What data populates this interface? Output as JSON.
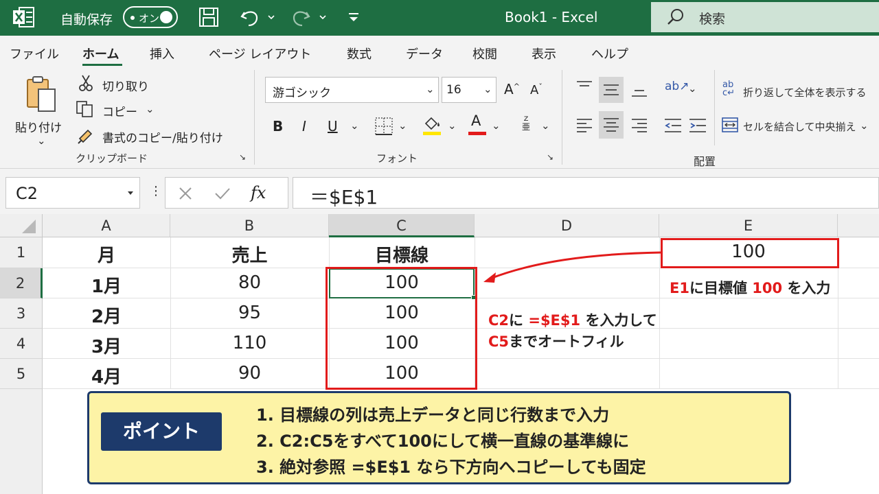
{
  "titlebar": {
    "autosave_label": "自動保存",
    "autosave_state": "オン",
    "doc_title": "Book1  -  Excel",
    "search_placeholder": "検索"
  },
  "tabs": [
    "ファイル",
    "ホーム",
    "挿入",
    "ページ レイアウト",
    "数式",
    "データ",
    "校閲",
    "表示",
    "ヘルプ"
  ],
  "active_tab": "ホーム",
  "ribbon": {
    "clipboard": {
      "paste": "貼り付け",
      "cut": "切り取り",
      "copy": "コピー",
      "format_painter": "書式のコピー/貼り付け",
      "group_label": "クリップボード"
    },
    "font": {
      "font_name": "游ゴシック",
      "font_size": "16",
      "bold": "B",
      "italic": "I",
      "underline": "U",
      "group_label": "フォント",
      "fill_color": "#ffe600",
      "font_color": "#e21b1b"
    },
    "alignment": {
      "wrap_text": "折り返して全体を表示する",
      "merge_center": "セルを結合して中央揃え",
      "group_label": "配置"
    }
  },
  "formula_bar": {
    "name_box": "C2",
    "formula": "＝$E$1"
  },
  "sheet": {
    "columns": [
      "A",
      "B",
      "C",
      "D",
      "E"
    ],
    "selected_column": "C",
    "rows": [
      "1",
      "2",
      "3",
      "4",
      "5"
    ],
    "selected_row": "2",
    "headers": {
      "A": "月",
      "B": "売上",
      "C": "目標線"
    },
    "data": [
      {
        "month": "1月",
        "sales": "80",
        "target": "100"
      },
      {
        "month": "2月",
        "sales": "95",
        "target": "100"
      },
      {
        "month": "3月",
        "sales": "110",
        "target": "100"
      },
      {
        "month": "4月",
        "sales": "90",
        "target": "100"
      }
    ],
    "e1": "100"
  },
  "annotations": {
    "e1_ref": "E1",
    "e1_mid": "に目標値",
    "e1_val": "100",
    "e1_tail": "を入力",
    "c2_ref": "C2",
    "c2_mid": "に",
    "c2_formula": "=$E$1",
    "c2_tail": "を入力して",
    "c5_ref": "C5",
    "c5_tail": "までオートフィル"
  },
  "point": {
    "badge": "ポイント",
    "lines": [
      "1.  目標線の列は売上データと同じ行数まで入力",
      "2.  C2:C5をすべて100にして横一直線の基準線に",
      "3.  絶対参照 =$E$1 なら下方向へコピーしても固定"
    ]
  },
  "colors": {
    "excel_green": "#1e6e42",
    "highlight_red": "#e21b1b",
    "point_bg": "#fdf3a6",
    "point_navy": "#1d3a6b"
  }
}
